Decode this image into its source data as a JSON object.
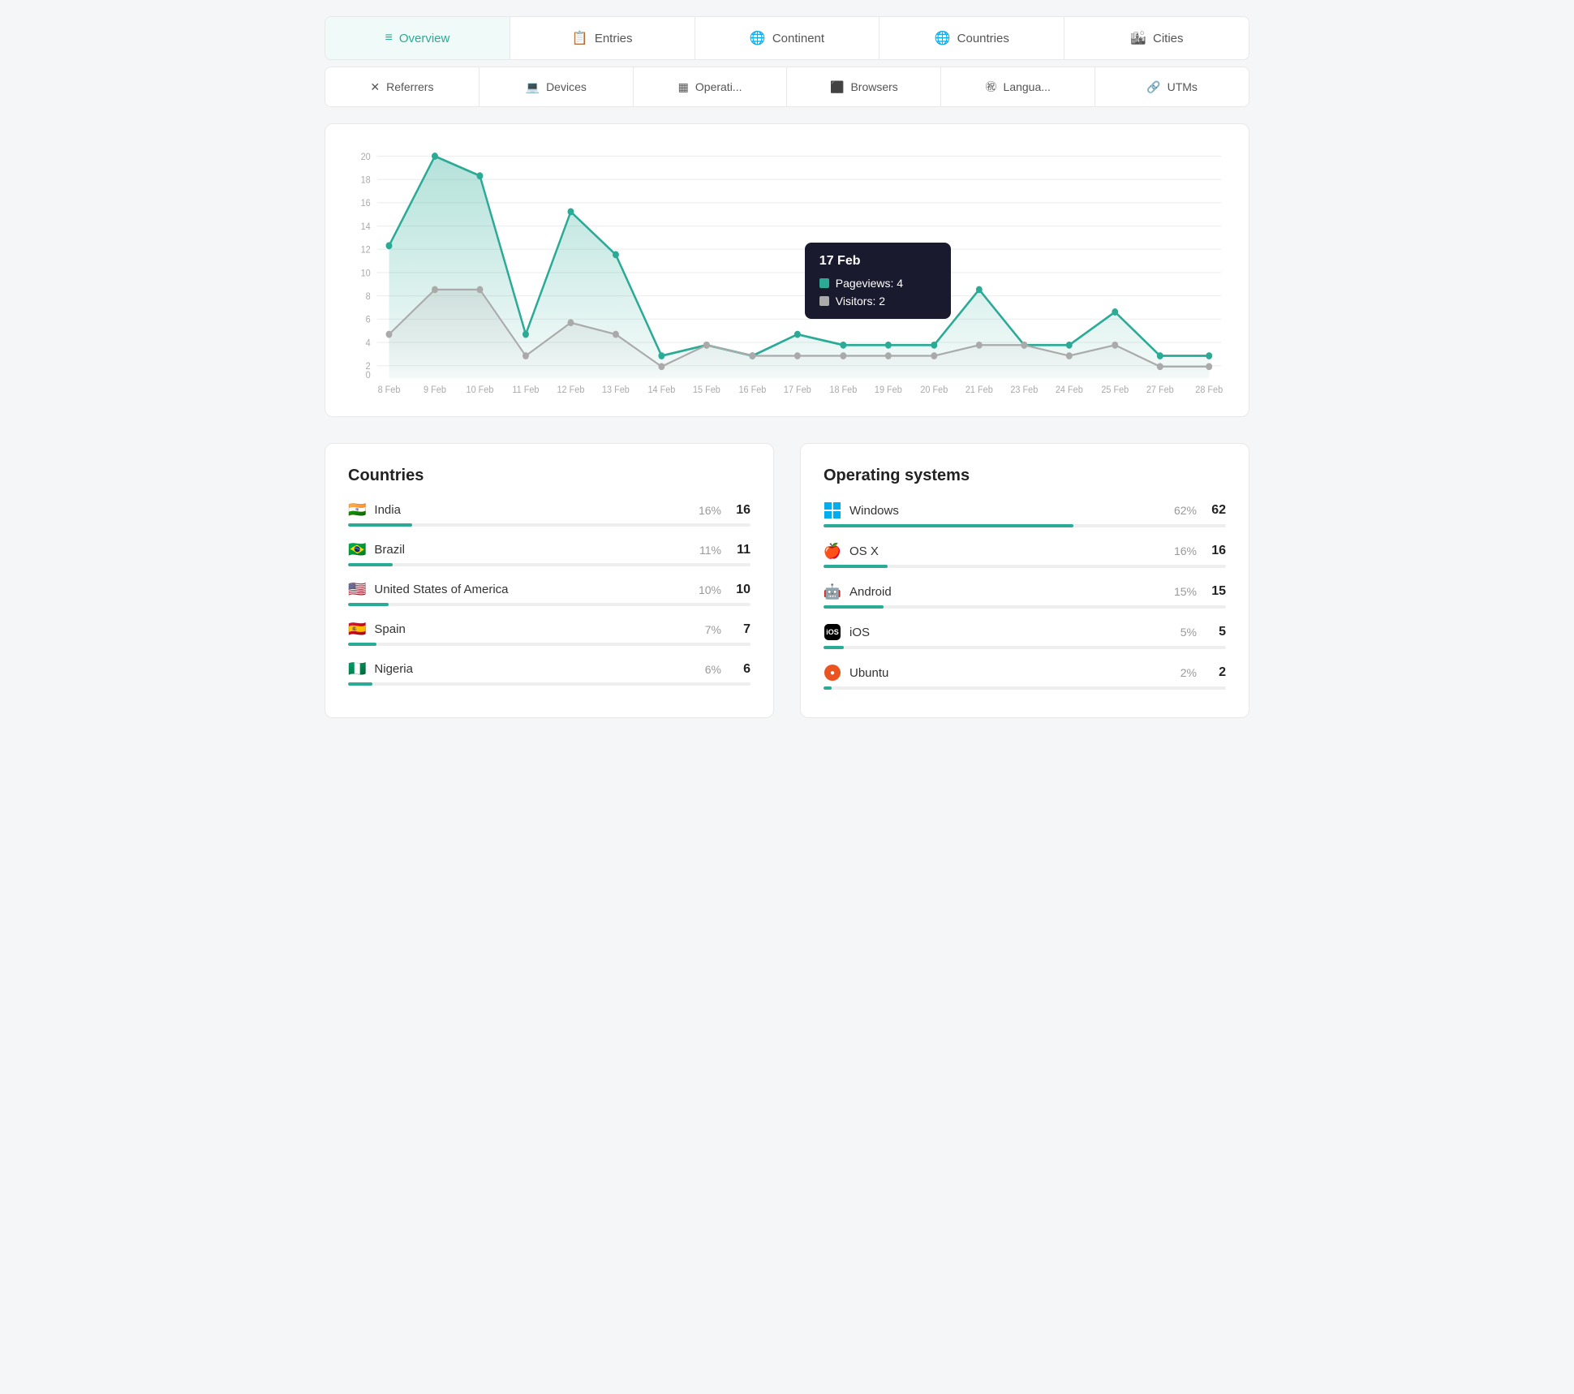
{
  "tabs1": [
    {
      "id": "overview",
      "label": "Overview",
      "icon": "≡",
      "active": true
    },
    {
      "id": "entries",
      "label": "Entries",
      "icon": "📋"
    },
    {
      "id": "continent",
      "label": "Continent",
      "icon": "🌐"
    },
    {
      "id": "countries",
      "label": "Countries",
      "icon": "🌐"
    },
    {
      "id": "cities",
      "label": "Cities",
      "icon": "🏙"
    }
  ],
  "tabs2": [
    {
      "id": "referrers",
      "label": "Referrers",
      "icon": "✕"
    },
    {
      "id": "devices",
      "label": "Devices",
      "icon": "💻"
    },
    {
      "id": "operating",
      "label": "Operati...",
      "icon": "▦"
    },
    {
      "id": "browsers",
      "label": "Browsers",
      "icon": "⬜"
    },
    {
      "id": "languages",
      "label": "Langua...",
      "icon": "㊗"
    },
    {
      "id": "utms",
      "label": "UTMs",
      "icon": "🔗"
    }
  ],
  "chart": {
    "yLabels": [
      "0",
      "2",
      "4",
      "6",
      "8",
      "10",
      "12",
      "14",
      "16",
      "18",
      "20"
    ],
    "xLabels": [
      "8 Feb",
      "9 Feb",
      "10 Feb",
      "11 Feb",
      "12 Feb",
      "13 Feb",
      "14 Feb",
      "15 Feb",
      "16 Feb",
      "17 Feb",
      "18 Feb",
      "19 Feb",
      "20 Feb",
      "21 Feb",
      "23 Feb",
      "24 Feb",
      "25 Feb",
      "27 Feb",
      "28 Feb"
    ],
    "tooltip": {
      "date": "17 Feb",
      "pageviews_label": "Pageviews: 4",
      "visitors_label": "Visitors: 2",
      "pageviews_color": "#2bab96",
      "visitors_color": "#aaa"
    }
  },
  "countries": {
    "title": "Countries",
    "items": [
      {
        "flag": "🇮🇳",
        "name": "India",
        "pct": "16%",
        "count": 16,
        "bar": 16
      },
      {
        "flag": "🇧🇷",
        "name": "Brazil",
        "pct": "11%",
        "count": 11,
        "bar": 11
      },
      {
        "flag": "🇺🇸",
        "name": "United States of America",
        "pct": "10%",
        "count": 10,
        "bar": 10
      },
      {
        "flag": "🇪🇸",
        "name": "Spain",
        "pct": "7%",
        "count": 7,
        "bar": 7
      },
      {
        "flag": "🇳🇬",
        "name": "Nigeria",
        "pct": "6%",
        "count": 6,
        "bar": 6
      }
    ]
  },
  "operating_systems": {
    "title": "Operating systems",
    "items": [
      {
        "icon": "windows",
        "name": "Windows",
        "pct": "62%",
        "count": 62,
        "bar": 62
      },
      {
        "icon": "apple",
        "name": "OS X",
        "pct": "16%",
        "count": 16,
        "bar": 16
      },
      {
        "icon": "android",
        "name": "Android",
        "pct": "15%",
        "count": 15,
        "bar": 15
      },
      {
        "icon": "ios",
        "name": "iOS",
        "pct": "5%",
        "count": 5,
        "bar": 5
      },
      {
        "icon": "ubuntu",
        "name": "Ubuntu",
        "pct": "2%",
        "count": 2,
        "bar": 2
      }
    ]
  },
  "colors": {
    "teal": "#2bab96",
    "teal_light": "#e0f5f2",
    "gray_line": "#aaa",
    "accent_active": "#2bab96"
  }
}
